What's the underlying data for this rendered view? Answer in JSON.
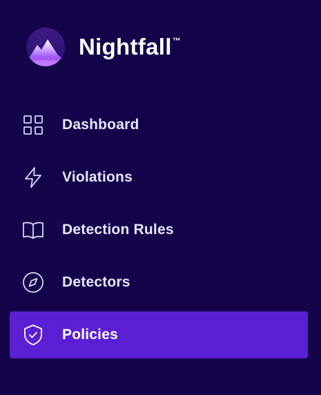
{
  "brand": {
    "name": "Nightfall",
    "trademark": "™"
  },
  "nav": {
    "items": [
      {
        "label": "Dashboard",
        "icon": "grid-icon",
        "active": false
      },
      {
        "label": "Violations",
        "icon": "lightning-icon",
        "active": false
      },
      {
        "label": "Detection Rules",
        "icon": "book-icon",
        "active": false
      },
      {
        "label": "Detectors",
        "icon": "compass-icon",
        "active": false
      },
      {
        "label": "Policies",
        "icon": "shield-check-icon",
        "active": true
      }
    ]
  },
  "colors": {
    "background": "#14044a",
    "active_item": "#5b1fd3",
    "text": "#e9e4ff",
    "icon": "#dcd6ff"
  }
}
